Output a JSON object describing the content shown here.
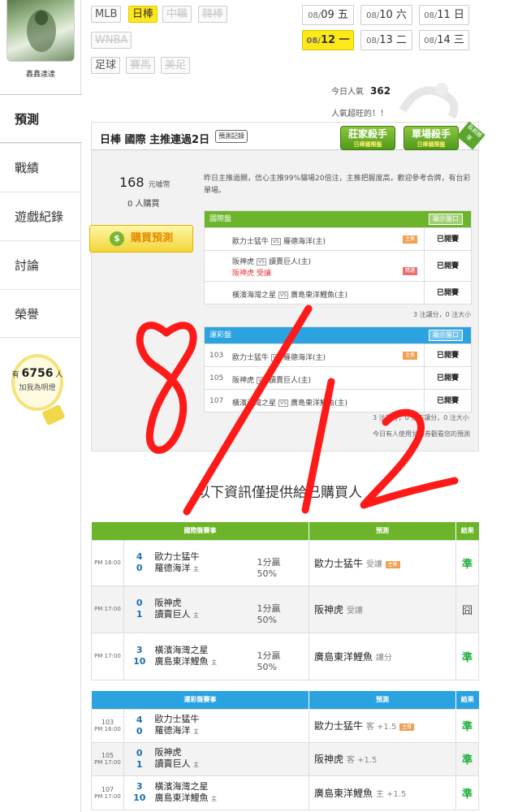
{
  "sidebar": {
    "username": "鑫鑫達達",
    "nav": [
      "預測",
      "戰績",
      "遊戲紀錄",
      "討論",
      "榮譽"
    ],
    "fans_prefix": "有",
    "fans_count": "6756",
    "fans_suffix": "人",
    "fans_sub": "加我為明燈"
  },
  "sports": [
    "MLB",
    "日棒",
    "中職",
    "韓棒",
    "WNBA",
    "足球",
    "賽馬",
    "美足"
  ],
  "dates": [
    {
      "md": "08/",
      "d": "09",
      "w": "五"
    },
    {
      "md": "08/",
      "d": "10",
      "w": "六"
    },
    {
      "md": "08/",
      "d": "11",
      "w": "日"
    },
    {
      "md": "08/",
      "d": "12",
      "w": "一"
    },
    {
      "md": "08/",
      "d": "13",
      "w": "二"
    },
    {
      "md": "08/",
      "d": "14",
      "w": "三"
    }
  ],
  "popularity": {
    "label": "今日人氣",
    "value": "362",
    "note": "人氣超旺的！！"
  },
  "panel": {
    "title": "日棒 國際 主推連過2日",
    "record_btn": "預測記錄",
    "badge1": "莊家殺手",
    "badge1_sub": "日棒國際盤",
    "badge2": "單場殺手",
    "badge2_sub": "日棒國際盤",
    "ribbon": "長期勝率",
    "price": "168",
    "price_unit": "元噱幣",
    "buyers": "0 人購買",
    "buy_btn": "購買預測",
    "desc": "昨日主推過關，信心主推99%貓場20倍注，主推把握度高，歡迎參考合牌，有台彩單場。",
    "intl": {
      "title": "國際盤",
      "show": "顯示盤口",
      "rows": [
        {
          "t1": "歐力士猛牛",
          "t2": "羅德海洋(主)",
          "sub": "",
          "mk": "主推",
          "st": "已開賽"
        },
        {
          "t1": "阪神虎",
          "t2": "讀賣巨人(主)",
          "sub": "阪神虎  受讓",
          "mk": "精選",
          "st": "已開賽"
        },
        {
          "t1": "橫濱海灣之星",
          "t2": "廣島東洋鯉魚(主)",
          "sub": "",
          "mk": "",
          "st": "已開賽"
        }
      ],
      "note": "3 注讓分，0 注大小"
    },
    "lottery": {
      "title": "運彩盤",
      "show": "顯示盤口",
      "rows": [
        {
          "no": "103",
          "t1": "歐力士猛牛",
          "t2": "羅德海洋(主)",
          "mk": "主推",
          "st": "已開賽"
        },
        {
          "no": "105",
          "t1": "阪神虎",
          "t2": "讀賣巨人(主)",
          "mk": "",
          "st": "已開賽"
        },
        {
          "no": "107",
          "t1": "橫濱海灣之星",
          "t2": "廣島東洋鯉魚(主)",
          "mk": "",
          "st": "已開賽"
        }
      ],
      "note": "3 注讓分，0 注不讓分，0 注大小",
      "note2": "今日有人使用兌換券觀看您的預測"
    }
  },
  "info_heading": "以下資訊僅提供給已購買人",
  "intl_table": {
    "headers": [
      "國際盤賽事",
      "預測",
      "結果"
    ],
    "rows": [
      {
        "time": "PM 16:00",
        "s1": "4",
        "s2": "0",
        "t1": "歐力士猛牛",
        "t2": "羅德海洋",
        "line": "1分贏",
        "pct": "50%",
        "pick": "歐力士猛牛",
        "hint": "受讓",
        "mk": "主推",
        "res": "準"
      },
      {
        "time": "PM 17:00",
        "s1": "0",
        "s2": "1",
        "t1": "阪神虎",
        "t2": "讀賣巨人",
        "line": "1分贏",
        "pct": "50%",
        "pick": "阪神虎",
        "hint": "受讓",
        "mk": "",
        "res": "囧"
      },
      {
        "time": "PM 17:00",
        "s1": "3",
        "s2": "10",
        "t1": "橫濱海灣之星",
        "t2": "廣島東洋鯉魚",
        "line": "1分贏",
        "pct": "50%",
        "pick": "廣島東洋鯉魚",
        "hint": "讓分",
        "mk": "",
        "res": "準"
      }
    ]
  },
  "lottery_table": {
    "headers": [
      "運彩盤賽事",
      "預測",
      "結果"
    ],
    "rows": [
      {
        "no": "103",
        "time": "PM 16:00",
        "s1": "4",
        "s2": "0",
        "t1": "歐力士猛牛",
        "t2": "羅德海洋",
        "pick": "歐力士猛牛",
        "hint": "客 +1.5",
        "mk": "主推",
        "res": "準"
      },
      {
        "no": "105",
        "time": "PM 17:00",
        "s1": "0",
        "s2": "1",
        "t1": "阪神虎",
        "t2": "讀賣巨人",
        "pick": "阪神虎",
        "hint": "客 +1.5",
        "mk": "",
        "res": "準"
      },
      {
        "no": "107",
        "time": "PM 17:00",
        "s1": "3",
        "s2": "10",
        "t1": "橫濱海灣之星",
        "t2": "廣島東洋鯉魚",
        "pick": "廣島東洋鯉魚",
        "hint": "主 +1.5",
        "mk": "",
        "res": "準"
      }
    ]
  },
  "home_mark": "主",
  "colors": {
    "green": "#6cb52a",
    "blue": "#2aa3e0",
    "yellow": "#ffe81a",
    "correct": "#1fae3a",
    "scrawl": "#ff1a1a"
  }
}
